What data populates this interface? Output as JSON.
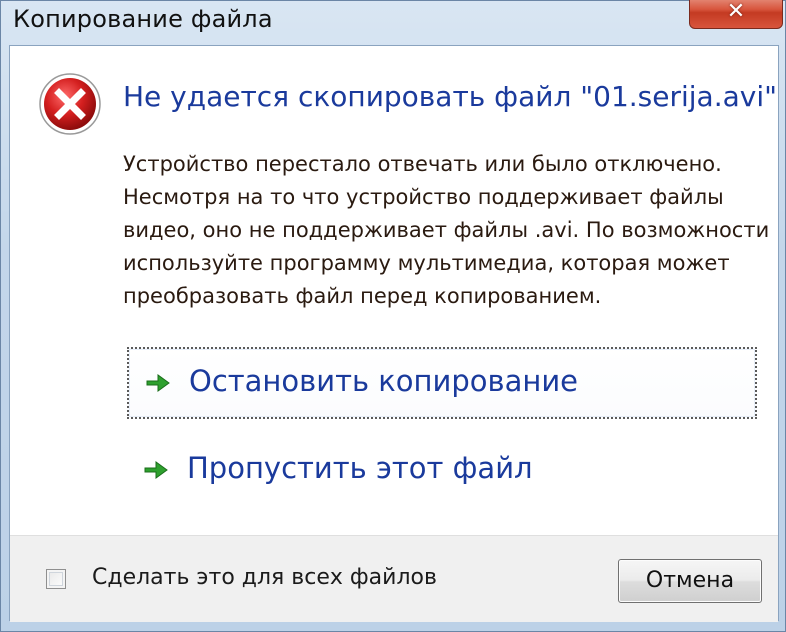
{
  "window": {
    "title": "Копирование файла",
    "close_symbol": "✕"
  },
  "dialog": {
    "icon": "error-icon",
    "main_instruction": "Не удается скопировать файл \"01.serija.avi\"",
    "description_lines": [
      "Устройство перестало отвечать или было отключено.",
      "Несмотря на то что устройство поддерживает файлы",
      "видео, оно не поддерживает файлы .avi. По возможности",
      "используйте программу мультимедиа, которая может",
      "преобразовать файл перед копированием."
    ],
    "commands": [
      {
        "label": "Остановить копирование",
        "icon": "green-arrow-icon"
      },
      {
        "label": "Пропустить этот файл",
        "icon": "green-arrow-icon"
      }
    ]
  },
  "footer": {
    "checkbox_label": "Сделать это для всех файлов",
    "checkbox_checked": false,
    "cancel_label": "Отмена"
  },
  "colors": {
    "instruction_blue": "#1a3a9c",
    "error_red": "#c8102e",
    "arrow_green": "#2ea02e"
  }
}
